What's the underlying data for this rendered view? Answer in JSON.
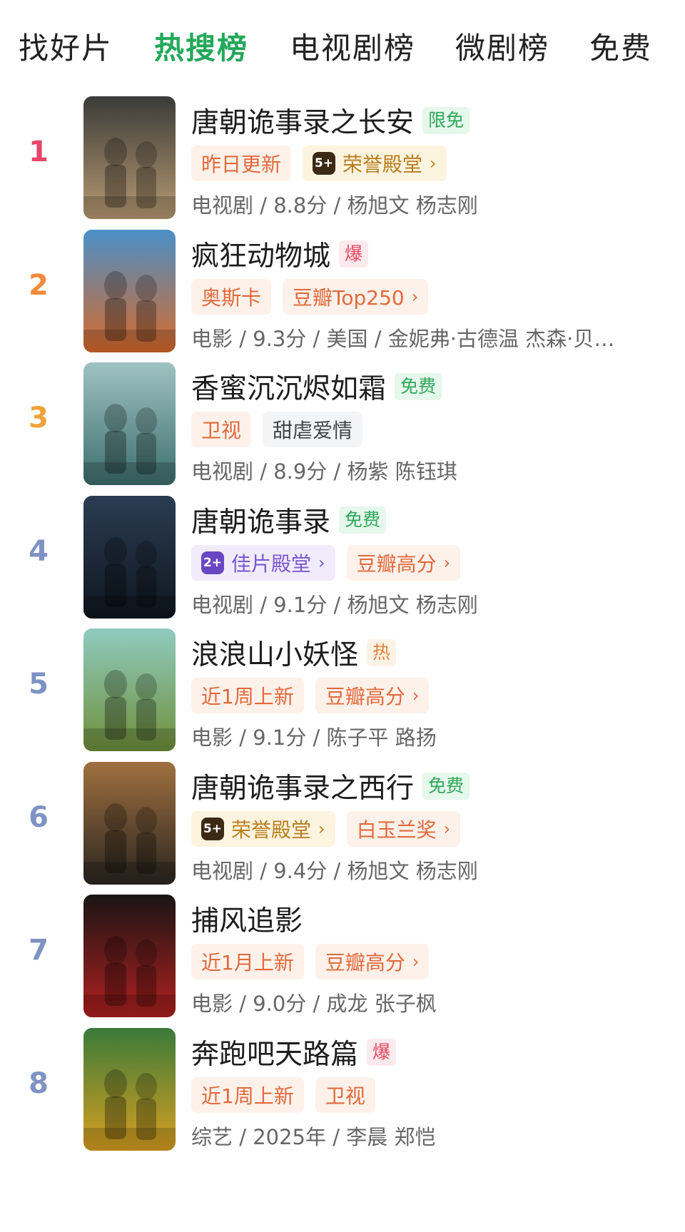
{
  "tabs": [
    {
      "label": "找好片",
      "active": false
    },
    {
      "label": "热搜榜",
      "active": true
    },
    {
      "label": "电视剧榜",
      "active": false
    },
    {
      "label": "微剧榜",
      "active": false
    },
    {
      "label": "免费",
      "active": false
    }
  ],
  "colors": {
    "active_tab": "#23a85a",
    "rank_1": "#e8446a",
    "rank_2": "#f08a3c",
    "rank_3": "#f2a23a",
    "rank_other": "#7e92c4",
    "tag_orange_bg": "#fdf1ea",
    "tag_orange_text": "#e06a3c",
    "tag_gold_bg": "#fdf4df",
    "tag_gold_text": "#b97d1e",
    "tag_purple_bg": "#f1ecfb",
    "tag_purple_text": "#7a57cf",
    "tag_grey_bg": "#f3f4f6",
    "tag_grey_text": "#444444",
    "badge_green_bg": "#e6f7ec",
    "badge_green_text": "#2fa85c",
    "badge_red_bg": "#fdeaee",
    "badge_red_text": "#e2475e",
    "badge_orange_bg": "#fdf2e6",
    "badge_orange_text": "#e0853a"
  },
  "items": [
    {
      "rank": "1",
      "title": "唐朝诡事录之长安",
      "badge": "限免",
      "badge_style": "green",
      "tags": [
        {
          "text": "昨日更新",
          "style": "orange",
          "chevron": false
        },
        {
          "text": "荣誉殿堂",
          "style": "gold",
          "chevron": true,
          "icon": "gold-medal-icon",
          "icon_text": "5+"
        }
      ],
      "meta": "电视剧 / 8.8分 / 杨旭文 杨志刚",
      "poster_colors": [
        "#3a3b38",
        "#b89a73"
      ]
    },
    {
      "rank": "2",
      "title": "疯狂动物城",
      "badge": "爆",
      "badge_style": "red",
      "tags": [
        {
          "text": "奥斯卡",
          "style": "orange",
          "chevron": false
        },
        {
          "text": "豆瓣Top250",
          "style": "orange",
          "chevron": true
        }
      ],
      "meta": "电影 / 9.3分 / 美国 / 金妮弗·古德温 杰森·贝…",
      "poster_colors": [
        "#4a8fc8",
        "#d86a2a"
      ]
    },
    {
      "rank": "3",
      "title": "香蜜沉沉烬如霜",
      "badge": "免费",
      "badge_style": "green",
      "tags": [
        {
          "text": "卫视",
          "style": "orange",
          "chevron": false
        },
        {
          "text": "甜虐爱情",
          "style": "grey",
          "chevron": false
        }
      ],
      "meta": "电视剧 / 8.9分 / 杨紫 陈钰琪",
      "poster_colors": [
        "#9fc2c2",
        "#3d6f6e"
      ]
    },
    {
      "rank": "4",
      "title": "唐朝诡事录",
      "badge": "免费",
      "badge_style": "green",
      "tags": [
        {
          "text": "佳片殿堂",
          "style": "purple",
          "chevron": true,
          "icon": "purple-medal-icon",
          "icon_text": "2+"
        },
        {
          "text": "豆瓣高分",
          "style": "orange",
          "chevron": true
        }
      ],
      "meta": "电视剧 / 9.1分 / 杨旭文 杨志刚",
      "poster_colors": [
        "#2b3c52",
        "#0f1720"
      ]
    },
    {
      "rank": "5",
      "title": "浪浪山小妖怪",
      "badge": "热",
      "badge_style": "orange",
      "tags": [
        {
          "text": "近1周上新",
          "style": "orange",
          "chevron": false
        },
        {
          "text": "豆瓣高分",
          "style": "orange",
          "chevron": true
        }
      ],
      "meta": "电影 / 9.1分 / 陈子平 路扬",
      "poster_colors": [
        "#8fcbc0",
        "#6f8f3a"
      ]
    },
    {
      "rank": "6",
      "title": "唐朝诡事录之西行",
      "badge": "免费",
      "badge_style": "green",
      "tags": [
        {
          "text": "荣誉殿堂",
          "style": "gold",
          "chevron": true,
          "icon": "gold-medal-icon",
          "icon_text": "5+"
        },
        {
          "text": "白玉兰奖",
          "style": "orange",
          "chevron": true
        }
      ],
      "meta": "电视剧 / 9.4分 / 杨旭文 杨志刚",
      "poster_colors": [
        "#a07040",
        "#2a2620"
      ]
    },
    {
      "rank": "7",
      "title": "捕风追影",
      "badge": "",
      "badge_style": "none",
      "tags": [
        {
          "text": "近1月上新",
          "style": "orange",
          "chevron": false
        },
        {
          "text": "豆瓣高分",
          "style": "orange",
          "chevron": true
        }
      ],
      "meta": "电影 / 9.0分 / 成龙 张子枫",
      "poster_colors": [
        "#1a1515",
        "#b02020"
      ]
    },
    {
      "rank": "8",
      "title": "奔跑吧天路篇",
      "badge": "爆",
      "badge_style": "red",
      "tags": [
        {
          "text": "近1周上新",
          "style": "orange",
          "chevron": false
        },
        {
          "text": "卫视",
          "style": "orange",
          "chevron": false
        }
      ],
      "meta": "综艺 / 2025年 / 李晨 郑恺",
      "poster_colors": [
        "#3a7a3a",
        "#d9a020"
      ]
    }
  ],
  "icons": {
    "chevron": "›"
  }
}
